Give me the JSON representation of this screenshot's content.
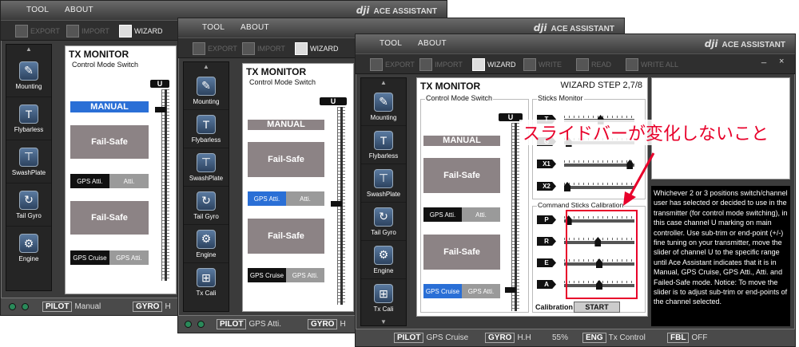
{
  "app": {
    "brand_logo": "dji",
    "brand_name": "ACE ASSISTANT"
  },
  "menu": {
    "tool": "TOOL",
    "about": "ABOUT"
  },
  "toolbar": {
    "export": "EXPORT",
    "import": "IMPORT",
    "wizard": "WIZARD",
    "write": "WRITE",
    "read": "READ",
    "write_all": "WRITE ALL"
  },
  "window_controls": {
    "minimize": "_",
    "close": "×"
  },
  "sidebar": [
    {
      "label": "Mounting",
      "icon": "mounting-icon"
    },
    {
      "label": "Flybarless",
      "icon": "flybarless-icon"
    },
    {
      "label": "SwashPlate",
      "icon": "swashplate-icon"
    },
    {
      "label": "Tail Gyro",
      "icon": "tail-gyro-icon"
    },
    {
      "label": "Engine",
      "icon": "engine-icon"
    },
    {
      "label": "Tx Cali",
      "icon": "tx-cali-icon"
    }
  ],
  "arrows": {
    "up": "▲",
    "down": "▼"
  },
  "tx_monitor": {
    "title": "TX MONITOR",
    "control_mode_switch": "Control Mode Switch",
    "channel": "U",
    "manual": "MANUAL",
    "fail_safe": "Fail-Safe",
    "gps_atti": "GPS Atti.",
    "atti": "Atti.",
    "gps_cruise": "GPS Cruise"
  },
  "wizard_step": "WIZARD STEP 2,7/8",
  "sticks_monitor": {
    "title": "Sticks Monitor",
    "rows": [
      {
        "label": "T",
        "value": 0.52
      },
      {
        "label": "G",
        "value": 0.02
      },
      {
        "label": "X1",
        "value": 0.98
      },
      {
        "label": "X2",
        "value": 0.0
      }
    ]
  },
  "calibration": {
    "title": "Command Sticks Calibration",
    "rows": [
      {
        "label": "P",
        "value": 0.02
      },
      {
        "label": "R",
        "value": 0.48
      },
      {
        "label": "E",
        "value": 0.5
      },
      {
        "label": "A",
        "value": 0.5
      }
    ],
    "calibration_label": "Calibration",
    "start_button": "START"
  },
  "annotation": "スライドバーが変化しないこと",
  "help_text": "Whichever 2 or 3 positions switch/channel user has selected or decided to use in the transmitter (for control mode switching), in this case channel U marking on main controller. Use sub-trim or end-point (+/-) fine tuning on your transmitter, move the slider of channel U to the specific range until Ace Assistant indicates that it is in Manual, GPS Cruise, GPS Atti., Atti. and Failed-Safe mode. Notice: To move the slider is to adjust sub-trim or end-points of the channel selected.",
  "status_bars": [
    {
      "pilot_label": "PILOT",
      "pilot_value": "Manual",
      "gyro_label": "GYRO",
      "gyro_value": "H"
    },
    {
      "pilot_label": "PILOT",
      "pilot_value": "GPS Atti.",
      "gyro_label": "GYRO",
      "gyro_value": "H"
    },
    {
      "pilot_label": "PILOT",
      "pilot_value": "GPS Cruise",
      "gyro_label": "GYRO",
      "gyro_value": "H.H",
      "gain": "55%",
      "eng_label": "ENG",
      "eng_value": "Tx Control",
      "fbl_label": "FBL",
      "fbl_value": "OFF"
    }
  ],
  "colors": {
    "selected_mode": "#2a6fd6",
    "annotation": "#e8002a",
    "fail_safe": "#8c8385"
  }
}
